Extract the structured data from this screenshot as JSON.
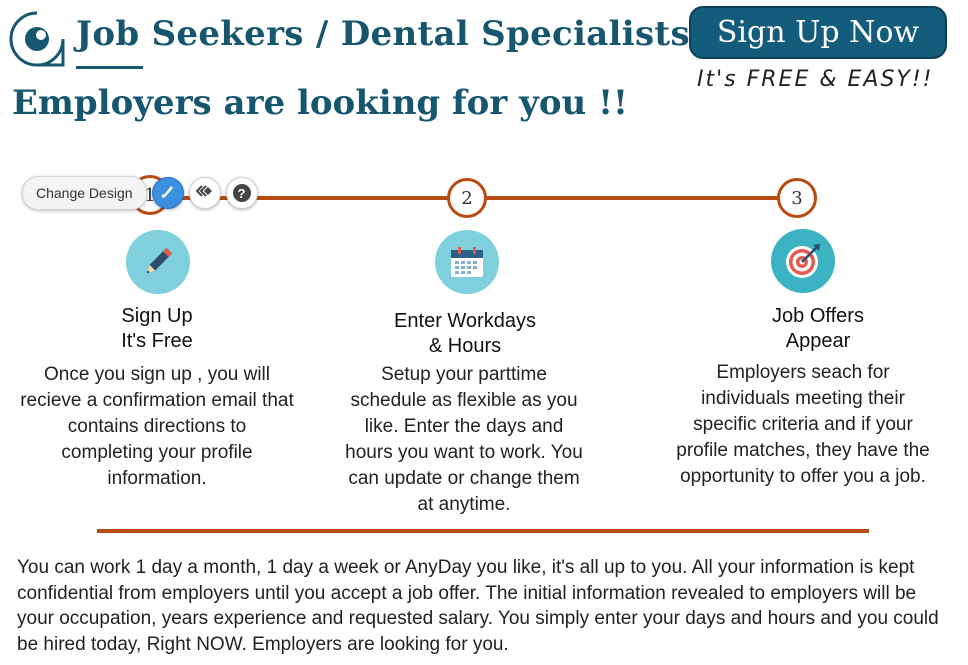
{
  "header": {
    "title": "Job Seekers / Dental Specialists",
    "headline": "Employers are looking for you !!"
  },
  "cta": {
    "signup_label": "Sign Up Now",
    "free_note": "It's FREE & EASY!!"
  },
  "editor": {
    "change_design_label": "Change Design",
    "help_label": "?"
  },
  "steps": [
    {
      "number": "1",
      "title_line1": "Sign Up",
      "title_line2": "It's Free",
      "icon": "pencil-icon",
      "color": "#7fd0dc",
      "text": "Once you sign up , you will recieve a confirmation email that contains directions to completing  your profile information."
    },
    {
      "number": "2",
      "title_line1": "Enter Workdays",
      "title_line2": "& Hours",
      "icon": "calendar-icon",
      "color": "#7fd0dc",
      "text": "Setup your parttime schedule as flexible as you like. Enter the days and hours you want to work. You can update or change them at anytime."
    },
    {
      "number": "3",
      "title_line1": "Job Offers",
      "title_line2": "Appear",
      "icon": "target-icon",
      "color": "#3bb3c3",
      "text": "Employers seach for individuals meeting their specific criteria and if your profile matches, they have the opportunity to offer you a job."
    }
  ],
  "body_text": "You can work 1 day a month, 1 day a week or AnyDay you like, it's all up to you. All your information is kept confidential from employers until you accept a job offer. The initial information revealed to employers will be your occupation, years experience and requested salary. You simply enter your days and hours and you could be hired today, Right NOW. Employers are looking for you.",
  "colors": {
    "brand": "#16566f",
    "button": "#135c7b",
    "accent_line": "#b84a12"
  }
}
